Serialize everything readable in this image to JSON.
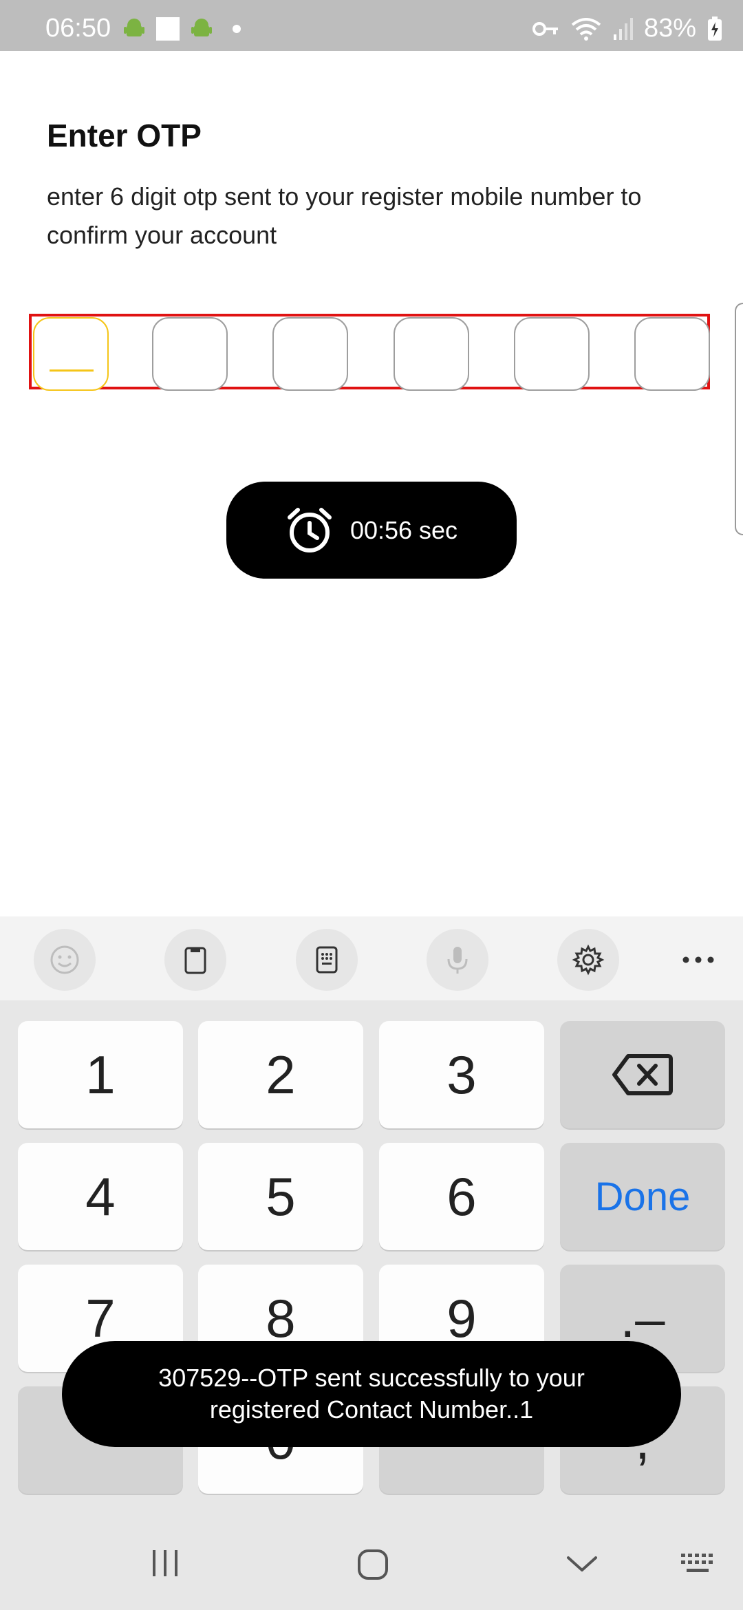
{
  "status_bar": {
    "time": "06:50",
    "battery": "83%"
  },
  "screen": {
    "title": "Enter OTP",
    "subtitle": "enter 6 digit otp sent to your register mobile number to confirm your account",
    "otp_digits": [
      "",
      "",
      "",
      "",
      "",
      ""
    ],
    "timer": "00:56 sec"
  },
  "keyboard": {
    "toolbar": [
      "emoji-icon",
      "clipboard-icon",
      "numpad-icon",
      "mic-icon",
      "gear-icon",
      "more-icon"
    ],
    "keys": {
      "k1": "1",
      "k2": "2",
      "k3": "3",
      "k4": "4",
      "k5": "5",
      "k6": "6",
      "done": "Done",
      "k7": "7",
      "k8": "8",
      "k9": "9",
      "dotdash": ".–",
      "k0": "0",
      "comma": ","
    }
  },
  "toast": {
    "line1": "307529--OTP sent successfully to your",
    "line2": "registered Contact Number..1"
  },
  "colors": {
    "accent_yellow": "#f5c518",
    "highlight_red": "#e01212",
    "done_blue": "#1a73e8"
  }
}
